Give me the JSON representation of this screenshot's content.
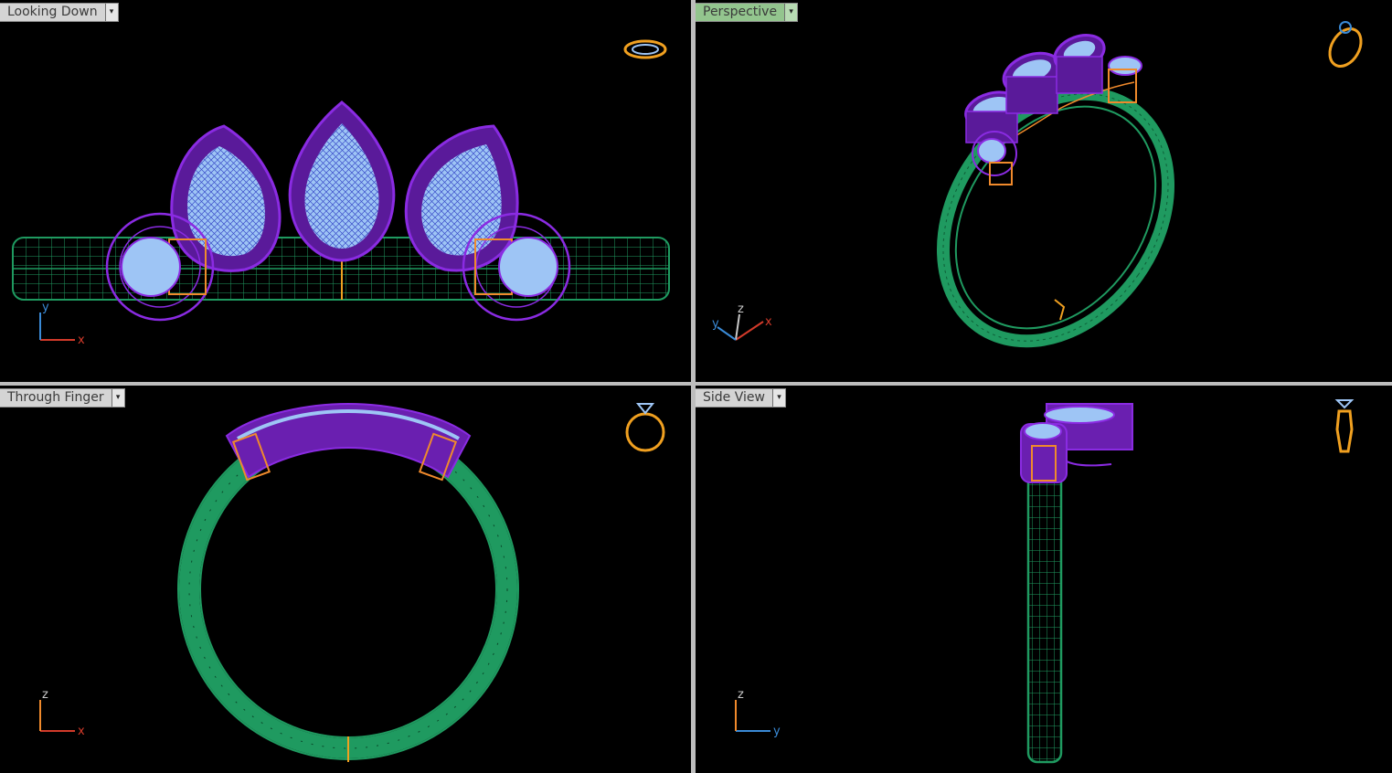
{
  "viewports": {
    "top": {
      "label": "Looking Down",
      "active": false
    },
    "perspective": {
      "label": "Perspective",
      "active": true
    },
    "front": {
      "label": "Through Finger",
      "active": false
    },
    "right": {
      "label": "Side View",
      "active": false
    }
  },
  "dropdown_glyph": "▾",
  "axes": {
    "top": {
      "horizontal": "x",
      "vertical": "y"
    },
    "perspective": {
      "a": "y",
      "b": "z",
      "c": "x"
    },
    "front": {
      "horizontal": "x",
      "vertical": "z"
    },
    "right": {
      "horizontal": "y",
      "vertical": "z"
    }
  },
  "colors": {
    "viewport_bg": "#000000",
    "band_green": "#1f9a60",
    "setting_purple": "#8a2be2",
    "stone_blue": "#9ec5f5",
    "prong_orange": "#f08a2c",
    "gizmo_gold": "#f0a020",
    "axis_x": "#d23a2a",
    "axis_y": "#3a8ad6",
    "axis_z": "#c9c9c9",
    "active_tab": "#93c58e"
  },
  "icons": {
    "view_gizmo": "ring-orientation-icon",
    "dropdown": "chevron-down-icon"
  }
}
